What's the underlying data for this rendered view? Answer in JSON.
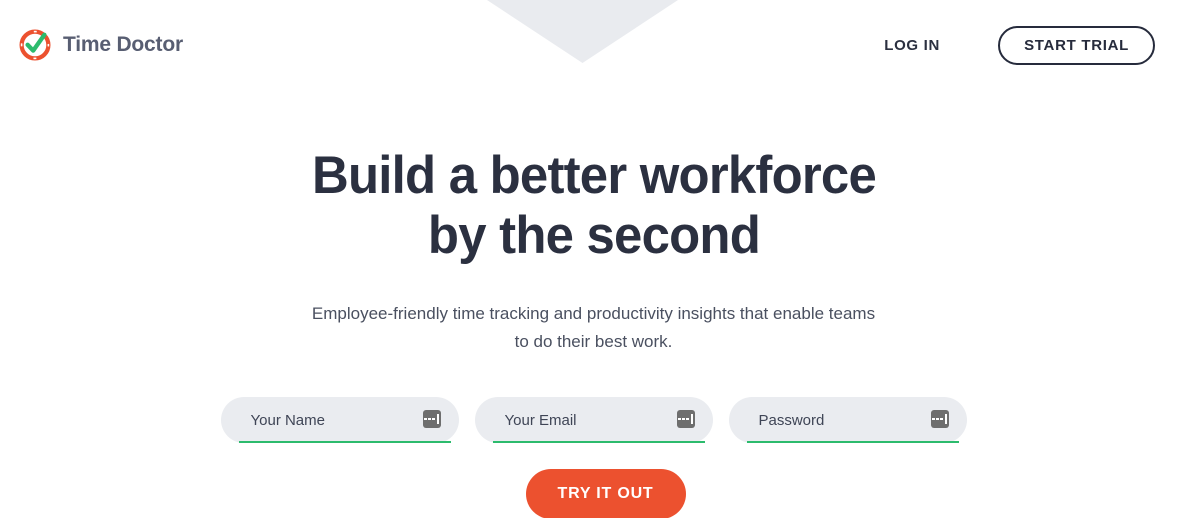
{
  "brand": {
    "name": "Time Doctor",
    "logo_icon": "time-doctor-check-circle-icon",
    "ring_color": "#ec512f",
    "check_color": "#2cbb6d",
    "name_color": "#585e72"
  },
  "header": {
    "login_label": "LOG IN",
    "start_trial_label": "START TRIAL",
    "border_color": "#262b3c"
  },
  "decor": {
    "chevron_color": "#e9ebef"
  },
  "hero": {
    "title_line1": "Build a better workforce",
    "title_line2": "by the second",
    "subtitle": "Employee-friendly time tracking and productivity insights that enable teams to do their best work.",
    "title_color": "#2b3040"
  },
  "form": {
    "fields": [
      {
        "name": "your-name",
        "placeholder": "Your Name",
        "value": "",
        "type": "text",
        "icon": "autofill-icon"
      },
      {
        "name": "your-email",
        "placeholder": "Your Email",
        "value": "",
        "type": "text",
        "icon": "autofill-icon"
      },
      {
        "name": "password",
        "placeholder": "Password",
        "value": "",
        "type": "text",
        "icon": "autofill-icon"
      }
    ],
    "underline_color": "#2cbb6d",
    "field_background": "#eaecf0",
    "submit_label": "TRY IT OUT",
    "submit_color": "#ec512f"
  }
}
